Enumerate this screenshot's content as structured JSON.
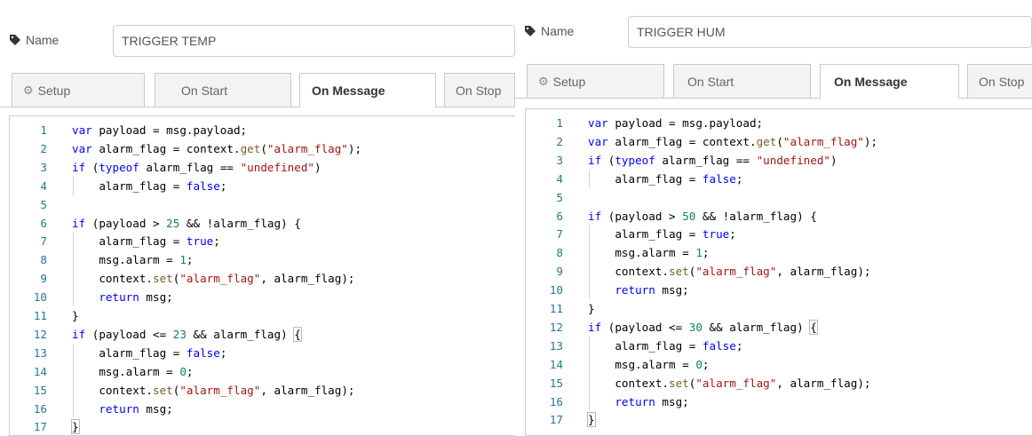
{
  "panels": [
    {
      "id": "left",
      "name_label": "Name",
      "name_value": "TRIGGER TEMP",
      "tabs": [
        {
          "label": "Setup",
          "icon": "gear-icon",
          "active": false
        },
        {
          "label": "On Start",
          "active": false
        },
        {
          "label": "On Message",
          "active": true
        },
        {
          "label": "On Stop",
          "active": false
        }
      ],
      "code_lines": [
        {
          "n": "1",
          "text": "var payload = msg.payload;"
        },
        {
          "n": "2",
          "text": "var alarm_flag = context.get(\"alarm_flag\");"
        },
        {
          "n": "3",
          "text": "if (typeof alarm_flag == \"undefined\")"
        },
        {
          "n": "4",
          "text": "    alarm_flag = false;"
        },
        {
          "n": "5",
          "text": ""
        },
        {
          "n": "6",
          "text": "if (payload > 25 && !alarm_flag) {"
        },
        {
          "n": "7",
          "text": "    alarm_flag = true;"
        },
        {
          "n": "8",
          "text": "    msg.alarm = 1;"
        },
        {
          "n": "9",
          "text": "    context.set(\"alarm_flag\", alarm_flag);"
        },
        {
          "n": "10",
          "text": "    return msg;"
        },
        {
          "n": "11",
          "text": "}"
        },
        {
          "n": "12",
          "text": "if (payload <= 23 && alarm_flag) {"
        },
        {
          "n": "13",
          "text": "    alarm_flag = false;"
        },
        {
          "n": "14",
          "text": "    msg.alarm = 0;"
        },
        {
          "n": "15",
          "text": "    context.set(\"alarm_flag\", alarm_flag);"
        },
        {
          "n": "16",
          "text": "    return msg;"
        },
        {
          "n": "17",
          "text": "}"
        }
      ]
    },
    {
      "id": "right",
      "name_label": "Name",
      "name_value": "TRIGGER HUM",
      "tabs": [
        {
          "label": "Setup",
          "icon": "gear-icon",
          "active": false
        },
        {
          "label": "On Start",
          "active": false
        },
        {
          "label": "On Message",
          "active": true
        },
        {
          "label": "On Stop",
          "active": false
        }
      ],
      "code_lines": [
        {
          "n": "1",
          "text": "var payload = msg.payload;"
        },
        {
          "n": "2",
          "text": "var alarm_flag = context.get(\"alarm_flag\");"
        },
        {
          "n": "3",
          "text": "if (typeof alarm_flag == \"undefined\")"
        },
        {
          "n": "4",
          "text": "    alarm_flag = false;"
        },
        {
          "n": "5",
          "text": ""
        },
        {
          "n": "6",
          "text": "if (payload > 50 && !alarm_flag) {"
        },
        {
          "n": "7",
          "text": "    alarm_flag = true;"
        },
        {
          "n": "8",
          "text": "    msg.alarm = 1;"
        },
        {
          "n": "9",
          "text": "    context.set(\"alarm_flag\", alarm_flag);"
        },
        {
          "n": "10",
          "text": "    return msg;"
        },
        {
          "n": "11",
          "text": "}"
        },
        {
          "n": "12",
          "text": "if (payload <= 30 && alarm_flag) {"
        },
        {
          "n": "13",
          "text": "    alarm_flag = false;"
        },
        {
          "n": "14",
          "text": "    msg.alarm = 0;"
        },
        {
          "n": "15",
          "text": "    context.set(\"alarm_flag\", alarm_flag);"
        },
        {
          "n": "16",
          "text": "    return msg;"
        },
        {
          "n": "17",
          "text": "}"
        }
      ]
    }
  ],
  "colors": {
    "keyword": "#0000ff",
    "string": "#a31515",
    "number": "#098658",
    "function": "#795e26",
    "line_number": "#237893"
  }
}
